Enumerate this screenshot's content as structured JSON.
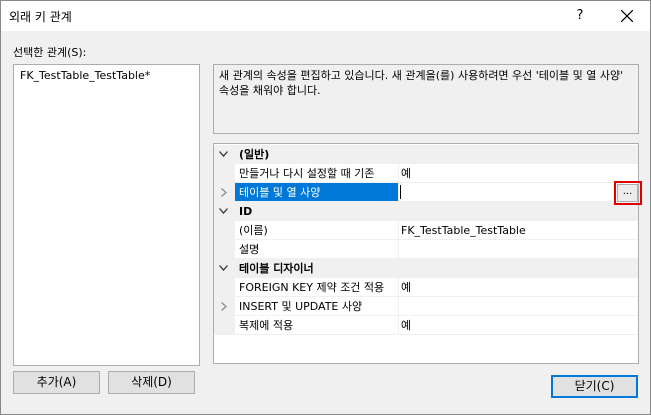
{
  "window": {
    "title": "외래 키 관계",
    "help_label": "?"
  },
  "relationships": {
    "label": "선택한 관계(S):",
    "items": [
      "FK_TestTable_TestTable*"
    ]
  },
  "description": "새 관계의 속성을 편집하고 있습니다. 새 관계을(를) 사용하려면 우선 '테이블 및 열 사양' 속성을 채워야 합니다.",
  "property_grid": {
    "rows": [
      {
        "type": "category",
        "name": "(일반)",
        "expanded": true
      },
      {
        "type": "property",
        "name": "만들거나 다시 설정할 때 기존",
        "value": "예"
      },
      {
        "type": "property",
        "name": "테이블 및 열 사양",
        "value": "",
        "expandable": true,
        "selected": true
      },
      {
        "type": "category",
        "name": "ID",
        "expanded": true
      },
      {
        "type": "property",
        "name": "(이름)",
        "value": "FK_TestTable_TestTable"
      },
      {
        "type": "property",
        "name": "설명",
        "value": ""
      },
      {
        "type": "category",
        "name": "테이블 디자이너",
        "expanded": true
      },
      {
        "type": "property",
        "name": "FOREIGN KEY 제약 조건 적용",
        "value": "예"
      },
      {
        "type": "property",
        "name": "INSERT 및 UPDATE 사양",
        "value": "",
        "expandable": true
      },
      {
        "type": "property",
        "name": "복제에 적용",
        "value": "예"
      }
    ],
    "ellipsis_label": "..."
  },
  "buttons": {
    "add": "추가(A)",
    "delete": "삭제(D)",
    "close": "닫기(C)"
  },
  "colors": {
    "selection": "#0078d7",
    "highlight_box": "#e00000",
    "dialog_bg": "#f0f0f0"
  }
}
